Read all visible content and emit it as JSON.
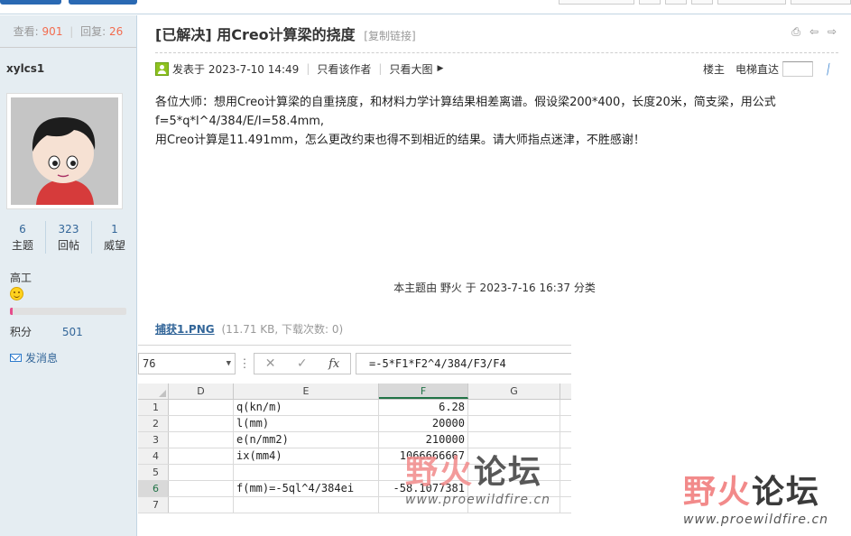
{
  "sidebar": {
    "stats": {
      "view_label": "查看:",
      "view_count": "901",
      "reply_label": "回复:",
      "reply_count": "26"
    },
    "username": "xylcs1",
    "counts": [
      {
        "value": "6",
        "label": "主题"
      },
      {
        "value": "323",
        "label": "回帖"
      },
      {
        "value": "1",
        "label": "威望"
      }
    ],
    "rank": "高工",
    "rank_progress": 0.02,
    "score_label": "积分",
    "score_value": "501",
    "message_label": "发消息"
  },
  "post": {
    "title": "[已解决] 用Creo计算梁的挠度",
    "copy_link": "[复制链接]",
    "posted_at": "发表于 2023-7-10 14:49",
    "only_author": "只看该作者",
    "view_large": "只看大图",
    "floor": "楼主",
    "jump_label": "电梯直达",
    "content_lines": [
      "各位大师：想用Creo计算梁的自重挠度，和材料力学计算结果相差离谱。假设梁200*400，长度20米，简支梁，用公式f=5*q*l^4/384/E/I=58.4mm,",
      "用Creo计算是11.491mm，怎么更改约束也得不到相近的结果。请大师指点迷津，不胜感谢！"
    ],
    "classify_note": "本主题由 野火 于 2023-7-16 16:37 分类",
    "attachment": {
      "name": "捕获1.PNG",
      "info": "(11.71 KB, 下载次数: 0)"
    }
  },
  "sheet": {
    "name_box": "76",
    "formula": "=-5*F1*F2^4/384/F3/F4",
    "columns": [
      "D",
      "E",
      "F",
      "G"
    ],
    "rows": [
      {
        "n": "1",
        "e": "q(kn/m)",
        "f": "6.28"
      },
      {
        "n": "2",
        "e": "l(mm)",
        "f": "20000"
      },
      {
        "n": "3",
        "e": "e(n/mm2)",
        "f": "210000"
      },
      {
        "n": "4",
        "e": "ix(mm4)",
        "f": "1066666667"
      },
      {
        "n": "5",
        "e": "",
        "f": ""
      },
      {
        "n": "6",
        "e": "f(mm)=-5ql^4/384ei",
        "f": "-58.1077381"
      },
      {
        "n": "7",
        "e": "",
        "f": ""
      }
    ]
  },
  "watermark": {
    "cn_a": "野火",
    "cn_b": "论坛",
    "url": "www.proewildfire.cn"
  }
}
